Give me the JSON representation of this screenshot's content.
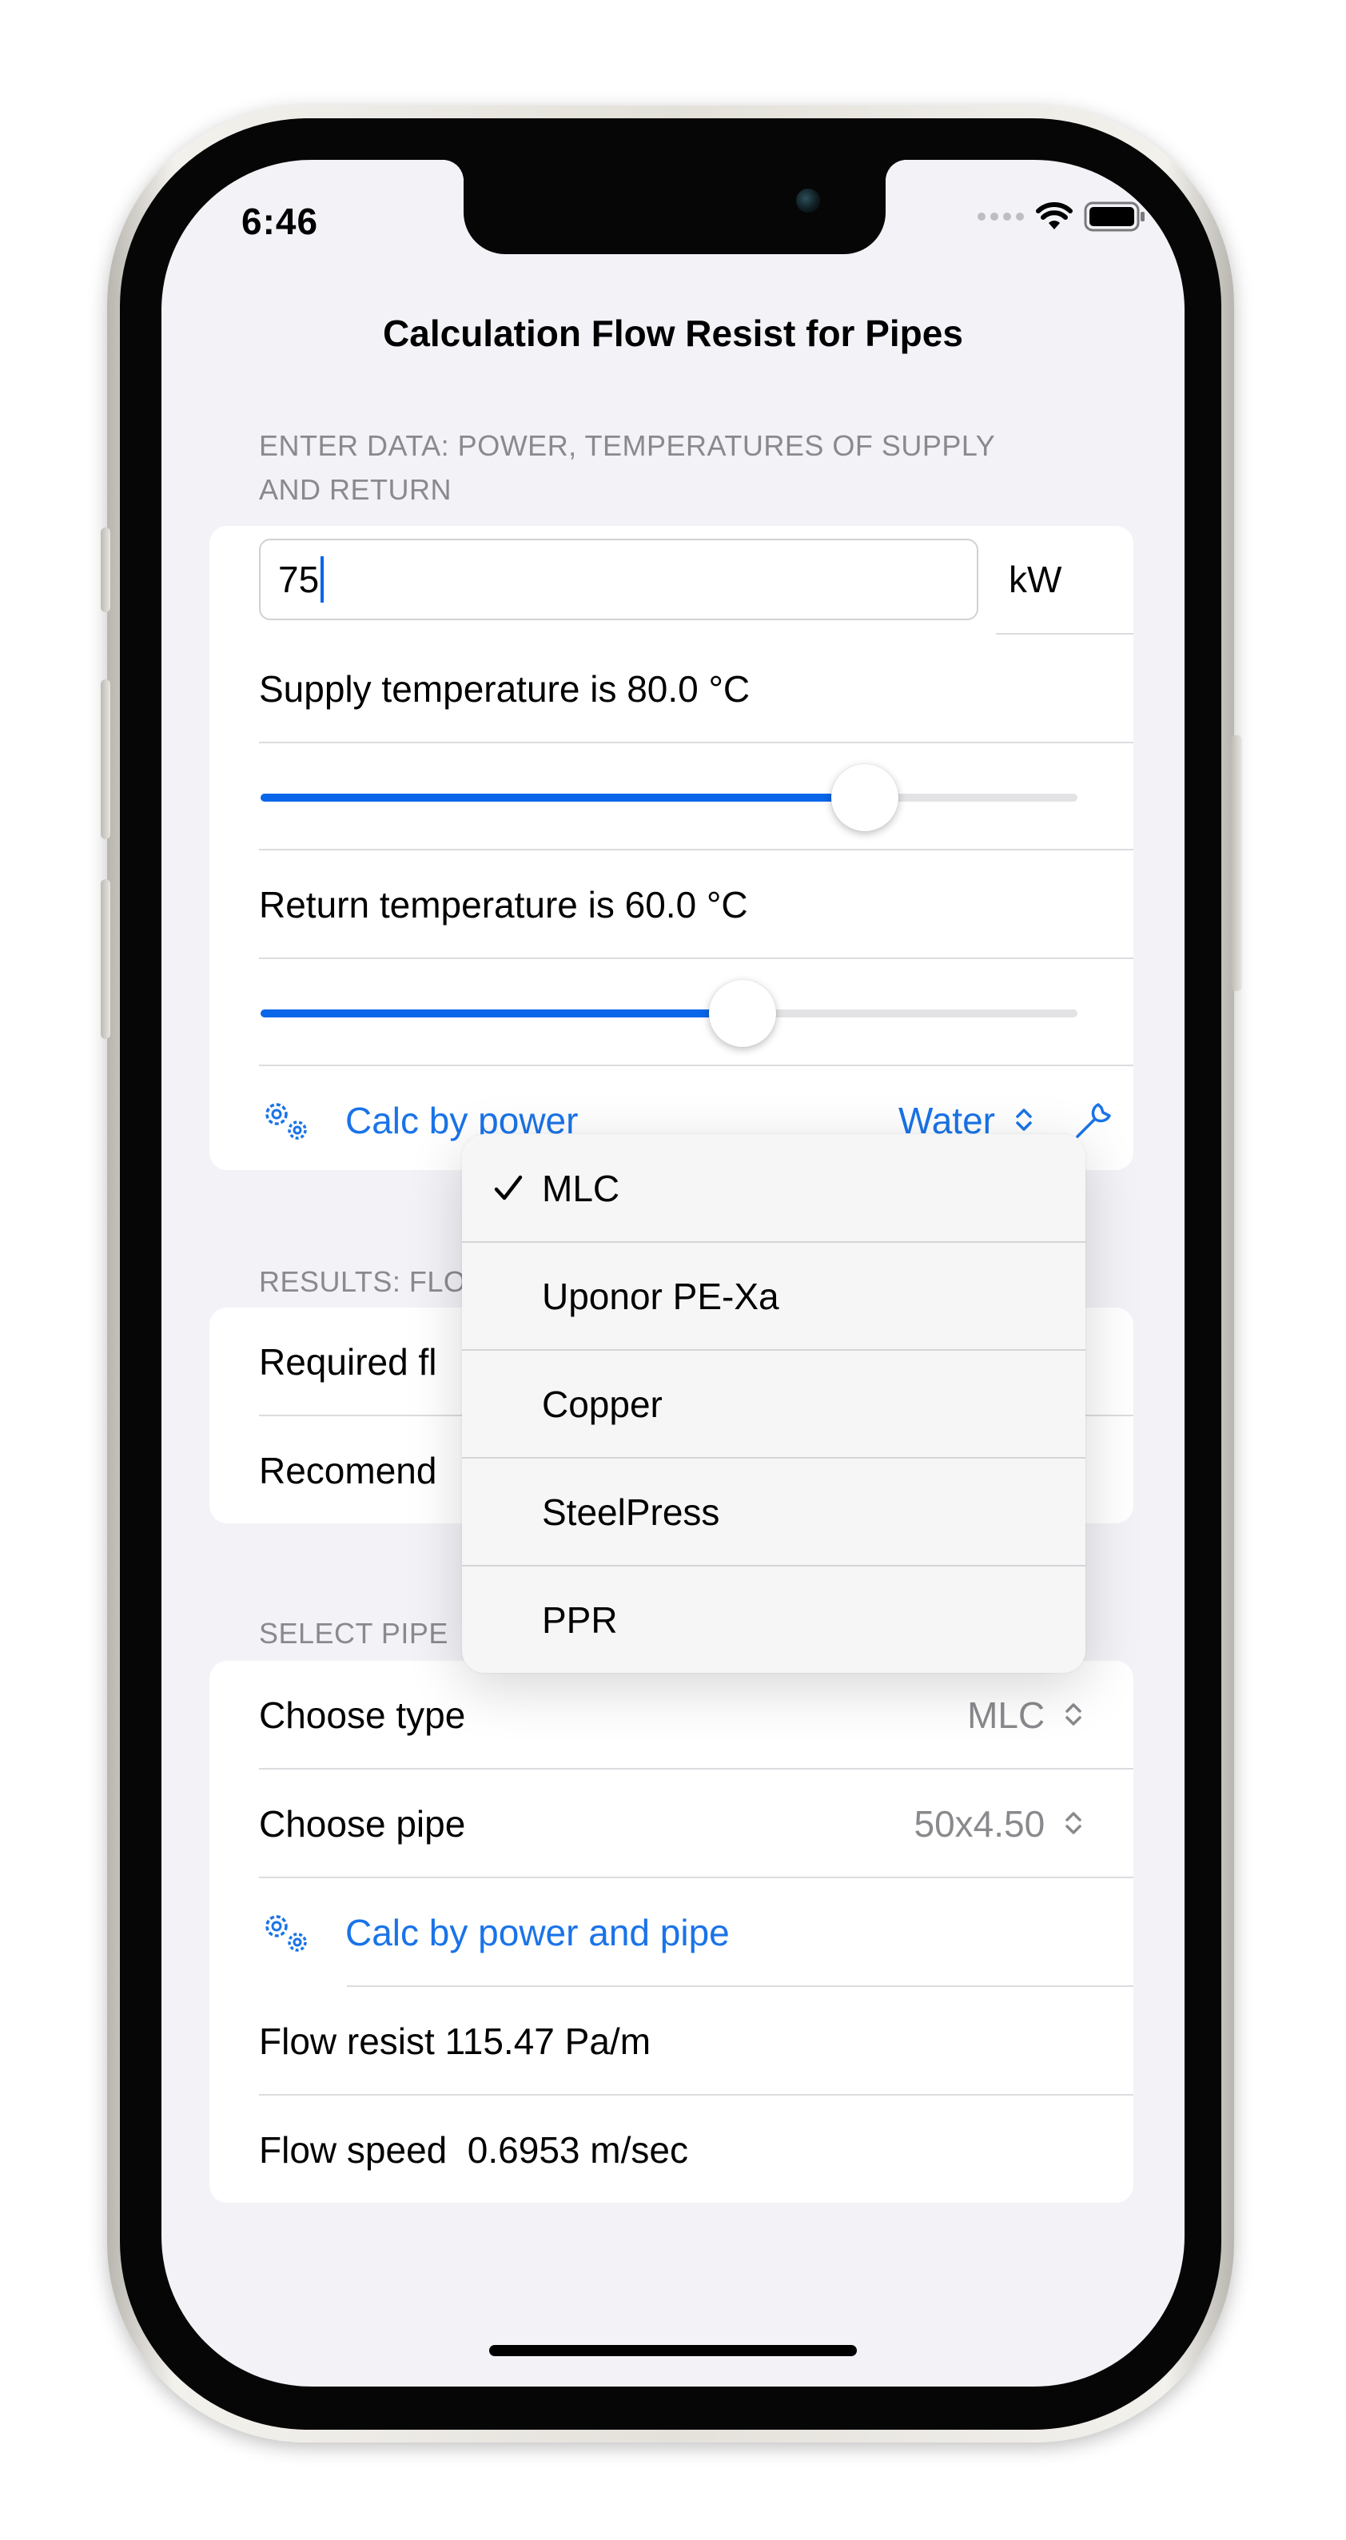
{
  "status_bar": {
    "time": "6:46"
  },
  "nav": {
    "title": "Calculation Flow Resist for Pipes"
  },
  "input_section": {
    "header": "ENTER DATA: POWER, TEMPERATURES OF SUPPLY AND RETURN",
    "power_value": "75",
    "power_unit": "kW",
    "supply_label": "Supply temperature is 80.0 °C",
    "supply_fraction": 0.74,
    "return_label": "Return temperature is 60.0 °C",
    "return_fraction": 0.59,
    "calc_button_label": "Calc by power",
    "fluid_value": "Water"
  },
  "results_section": {
    "header": "RESULTS: FLO",
    "row1_label": "Required fl",
    "row2_label": "Recomend"
  },
  "pipe_section": {
    "header": "SELECT PIPE",
    "type_label": "Choose type",
    "type_value": "MLC",
    "pipe_label": "Choose pipe",
    "pipe_value": "50x4.50",
    "calc_button_label": "Calc by power and pipe",
    "flow_resist": "Flow resist 115.47 Pa/m",
    "flow_speed": "Flow speed  0.6953 m/sec"
  },
  "type_menu": {
    "selected": "MLC",
    "items": [
      "MLC",
      "Uponor PE-Xa",
      "Copper",
      "SteelPress",
      "PPR"
    ]
  },
  "colors": {
    "accent": "#1a73e8",
    "background": "#f2f2f7",
    "secondary_text": "#8a8a8e"
  },
  "icons": [
    "wifi-icon",
    "battery-icon",
    "signal-dots-icon",
    "gears-icon",
    "wrench-icon",
    "chevron-updown-icon",
    "checkmark-icon"
  ]
}
